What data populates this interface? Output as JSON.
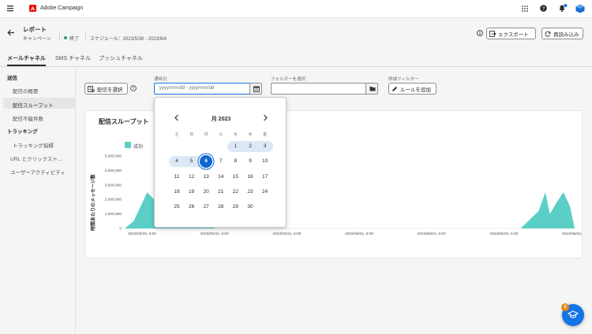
{
  "app": {
    "name": "Adobe Campaign",
    "notification_count": "1",
    "help_badge_count": "2"
  },
  "header": {
    "title": "レポート",
    "subtitle": "キャンペーン",
    "status": "終了",
    "schedule": "スケジュール：2023/5/30 - 2023/6/4",
    "export_label": "エクスポート",
    "reload_label": "再読み込み"
  },
  "tabs": [
    {
      "label": "メールチャネル",
      "active": true
    },
    {
      "label": "SMS チャネル",
      "active": false
    },
    {
      "label": "プッシュチャネル",
      "active": false
    }
  ],
  "sidebar": {
    "groups": [
      {
        "label": "送信",
        "items": [
          "配信の概要",
          "配信スループット",
          "配信不能件数"
        ]
      },
      {
        "label": "トラッキング",
        "items": [
          "トラッキング指標",
          "URL とクリックスト…",
          "ユーザーアクティビティ"
        ]
      }
    ],
    "selected": "配信スループット"
  },
  "filters": {
    "select_delivery_label": "配信を選択",
    "date_label": "通時日",
    "date_placeholder": "yyyy/mm/dd - yyyy/mm/dd",
    "folder_label": "フォルダーを選択",
    "advanced_label": "詳細フィルター",
    "add_rule_label": "ルールを追加"
  },
  "calendar": {
    "month_title": "月 2023",
    "weekdays": [
      "土",
      "日",
      "月",
      "火",
      "水",
      "木",
      "金"
    ],
    "weeks": [
      [
        "",
        "",
        "",
        "",
        "1",
        "2",
        "3"
      ],
      [
        "4",
        "5",
        "6",
        "7",
        "8",
        "9",
        "10"
      ],
      [
        "11",
        "12",
        "13",
        "14",
        "15",
        "16",
        "17"
      ],
      [
        "18",
        "19",
        "20",
        "21",
        "22",
        "23",
        "24"
      ],
      [
        "25",
        "26",
        "27",
        "28",
        "29",
        "30",
        ""
      ]
    ],
    "selected_day": "6",
    "range_highlight_days": [
      "1",
      "2",
      "3",
      "4",
      "5",
      "6"
    ]
  },
  "chart_card": {
    "title": "配信スループット"
  },
  "chart_data": {
    "type": "area",
    "title": "配信スループット",
    "ylabel": "時間あたりのメッセージ数",
    "legend": [
      {
        "name": "成功",
        "color": "#5bcfc6"
      }
    ],
    "ylim": [
      0,
      5000000
    ],
    "yticks": [
      "5,000,000",
      "4,000,000",
      "3,000,000",
      "2,000,000",
      "1,000,000",
      "0"
    ],
    "xticks": [
      "2023/05/30, 6:00",
      "2023/05/31, 6:00",
      "2023/05/31, 6:00",
      "2023/06/01, 6:00",
      "2023/06/01, 6:00",
      "2023/06/02, 6:00",
      "2023/06/02, 6:00"
    ],
    "series": [
      {
        "name": "成功",
        "color": "#5bcfc6",
        "values": [
          0,
          500000,
          2500000,
          1200000,
          4800000,
          5000000,
          3000000,
          0,
          0,
          0,
          0,
          0,
          0,
          0,
          1200000,
          2500000,
          1000000,
          1800000,
          2500000,
          1500000,
          0
        ],
        "points_at": [
          0,
          0.02,
          0.05,
          0.09,
          0.14,
          0.16,
          0.18,
          0.2,
          0.3,
          0.5,
          0.7,
          0.82,
          0.85,
          0.88,
          0.92,
          0.935,
          0.945,
          0.96,
          0.975,
          0.99,
          1.0
        ]
      }
    ]
  }
}
